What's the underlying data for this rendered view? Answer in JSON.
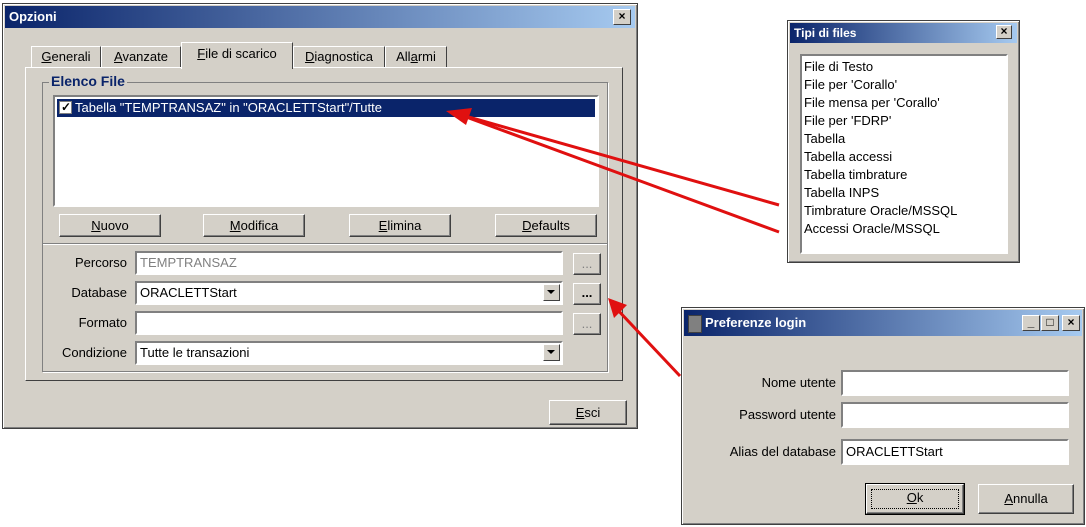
{
  "opzioni": {
    "title": "Opzioni",
    "close_glyph": "×",
    "tabs": [
      {
        "pre": "",
        "ul": "G",
        "post": "enerali"
      },
      {
        "pre": "",
        "ul": "A",
        "post": "vanzate"
      },
      {
        "pre": "",
        "ul": "F",
        "post": "ile di scarico"
      },
      {
        "pre": "",
        "ul": "D",
        "post": "iagnostica"
      },
      {
        "pre": "All",
        "ul": "a",
        "post": "rmi"
      }
    ],
    "active_tab": 2,
    "group_title": "Elenco File",
    "file_item": "Tabella \"TEMPTRANSAZ\" in \"ORACLETTStart\"/Tutte",
    "file_item_checked": true,
    "buttons": {
      "nuovo": {
        "pre": "",
        "ul": "N",
        "post": "uovo"
      },
      "modifica": {
        "pre": "",
        "ul": "M",
        "post": "odifica"
      },
      "elimina": {
        "pre": "",
        "ul": "E",
        "post": "limina"
      },
      "defaults": {
        "pre": "",
        "ul": "D",
        "post": "efaults"
      }
    },
    "fields": {
      "percorso_label": "Percorso",
      "percorso_value": "TEMPTRANSAZ",
      "database_label": "Database",
      "database_value": "ORACLETTStart",
      "formato_label": "Formato",
      "formato_value": "",
      "condizione_label": "Condizione",
      "condizione_value": "Tutte le transazioni"
    },
    "browse_label": "...",
    "esci": {
      "pre": "",
      "ul": "E",
      "post": "sci"
    }
  },
  "tipi": {
    "title": "Tipi di files",
    "close_glyph": "×",
    "items": [
      "File di Testo",
      "File per 'Corallo'",
      "File mensa per 'Corallo'",
      "File per 'FDRP'",
      "Tabella",
      "Tabella accessi",
      "Tabella timbrature",
      "Tabella INPS",
      "Timbrature Oracle/MSSQL",
      "Accessi Oracle/MSSQL"
    ]
  },
  "login": {
    "title": "Preferenze login",
    "min_glyph": "_",
    "max_glyph": "□",
    "close_glyph": "×",
    "nome_label": "Nome utente",
    "nome_value": "",
    "password_label": "Password utente",
    "password_value": "",
    "alias_label": "Alias del database",
    "alias_value": "ORACLETTStart",
    "ok": {
      "pre": "",
      "ul": "O",
      "post": "k"
    },
    "annulla": {
      "pre": "",
      "ul": "A",
      "post": "nnulla"
    }
  },
  "colors": {
    "arrow": "#e01010",
    "title_bar": "#0a246a",
    "selection": "#0a246a",
    "face": "#d4d0c8"
  }
}
